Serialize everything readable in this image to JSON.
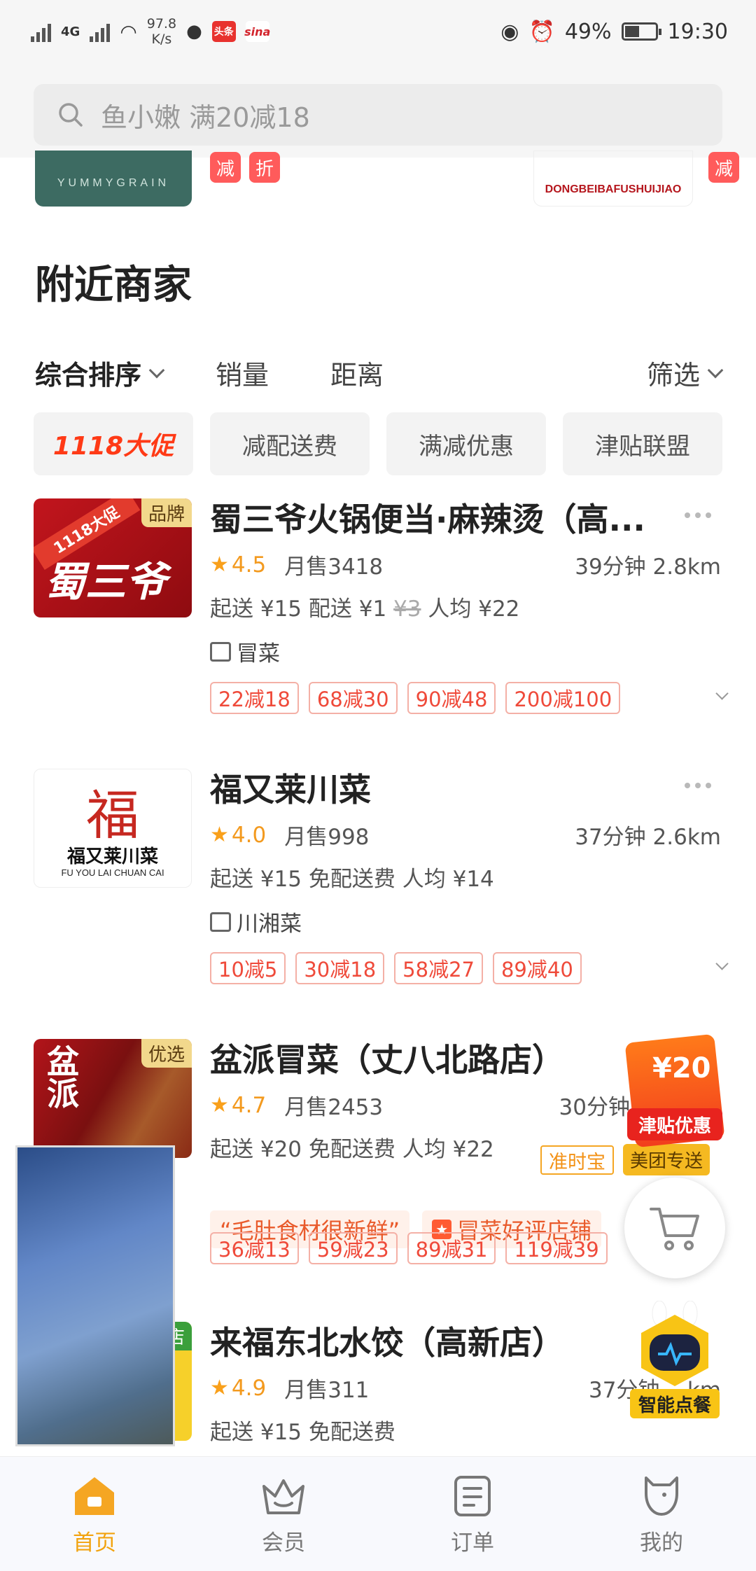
{
  "status": {
    "network": "4G",
    "speed": "97.8",
    "speed_unit": "K/s",
    "app1": "头条",
    "app2": "sina",
    "battery": "49%",
    "battery_level": 0.49,
    "time": "19:30"
  },
  "search": {
    "placeholder": "鱼小嫩 满20减18"
  },
  "strip": {
    "left_logo": "YUMMYGRAIN",
    "tag_a": "减",
    "tag_b": "折",
    "right_logo": "DONGBEIBAFUSHUIJIAO",
    "tag_c": "减"
  },
  "section": {
    "title": "附近商家"
  },
  "sort": {
    "items": [
      "综合排序",
      "销量",
      "距离"
    ],
    "filter": "筛选"
  },
  "chips": [
    "1118大促",
    "减配送费",
    "满减优惠",
    "津贴联盟"
  ],
  "stores": [
    {
      "badge": "品牌",
      "thumb_text": "蜀三爷",
      "thumb_ribbon": "1118大促",
      "name": "蜀三爷火锅便当·麻辣烫（高...",
      "rating": "4.5",
      "monthly": "月售3418",
      "time_dist": "39分钟  2.8km",
      "min_order": "起送 ¥15",
      "delivery": "配送 ¥1",
      "delivery_orig": "¥3",
      "per_person": "人均 ¥22",
      "category": "冒菜",
      "discounts": [
        "22减18",
        "68减30",
        "90减48",
        "200减100"
      ]
    },
    {
      "badge": "",
      "thumb_text": "福又莱川菜",
      "thumb_sub": "FU YOU LAI CHUAN CAI",
      "thumb_big": "福",
      "name": "福又莱川菜",
      "rating": "4.0",
      "monthly": "月售998",
      "time_dist": "37分钟  2.6km",
      "min_order": "起送 ¥15",
      "delivery": "免配送费",
      "per_person": "人均 ¥14",
      "category": "川湘菜",
      "discounts": [
        "10减5",
        "30减18",
        "58减27",
        "89减40"
      ]
    },
    {
      "badge": "优选",
      "thumb_text": "盆派",
      "name": "盆派冒菜（丈八北路店）",
      "rating": "4.7",
      "monthly": "月售2453",
      "time_dist": "30分钟",
      "min_order": "起送 ¥20",
      "delivery": "免配送费",
      "per_person": "人均 ¥22",
      "tag": "准时宝",
      "tag2": "美团专送",
      "highlights": [
        "“毛肚食材很新鲜”",
        "冒菜好评店铺"
      ],
      "discounts": [
        "36减13",
        "59减23",
        "89减31",
        "119减39"
      ]
    },
    {
      "badge": "店",
      "name": "来福东北水饺（高新店）",
      "rating": "4.9",
      "monthly": "月售311",
      "time_dist": "37分钟  ...km",
      "min_order": "起送 ¥15",
      "delivery": "免配送费"
    }
  ],
  "floating": {
    "jintie_amount": "¥20",
    "jintie_label": "津贴优惠",
    "robot_label": "智能点餐"
  },
  "tabs": [
    {
      "label": "首页",
      "icon": "home-icon"
    },
    {
      "label": "会员",
      "icon": "crown-icon"
    },
    {
      "label": "订单",
      "icon": "order-icon"
    },
    {
      "label": "我的",
      "icon": "profile-icon"
    }
  ],
  "colors": {
    "accent": "#f2a30f",
    "discount": "#ef4a3a",
    "rating": "#f39a1f"
  }
}
